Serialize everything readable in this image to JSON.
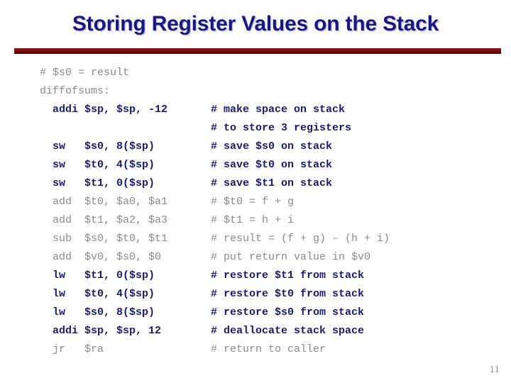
{
  "slide": {
    "title": "Storing Register Values on the Stack",
    "page_number": "11",
    "title_color": "#181880",
    "rule_color": "#7d0f10",
    "highlight_color": "#191970",
    "dim_color": "#8a8a8a"
  },
  "code": {
    "language": "mips-assembly",
    "lines": [
      {
        "text": "# $s0 = result",
        "comment": "",
        "style": "dim"
      },
      {
        "text": "diffofsums:",
        "comment": "",
        "style": "dim"
      },
      {
        "text": "  addi $sp, $sp, -12",
        "comment": "# make space on stack",
        "style": "hl"
      },
      {
        "text": "",
        "comment": "# to store 3 registers",
        "style": "hl"
      },
      {
        "text": "  sw   $s0, 8($sp)",
        "comment": "# save $s0 on stack",
        "style": "hl"
      },
      {
        "text": "  sw   $t0, 4($sp)",
        "comment": "# save $t0 on stack",
        "style": "hl"
      },
      {
        "text": "  sw   $t1, 0($sp)",
        "comment": "# save $t1 on stack",
        "style": "hl"
      },
      {
        "text": "  add  $t0, $a0, $a1",
        "comment": "# $t0 = f + g",
        "style": "dim"
      },
      {
        "text": "  add  $t1, $a2, $a3",
        "comment": "# $t1 = h + i",
        "style": "dim"
      },
      {
        "text": "  sub  $s0, $t0, $t1",
        "comment": "# result = (f + g) – (h + i)",
        "style": "dim"
      },
      {
        "text": "  add  $v0, $s0, $0",
        "comment": "# put return value in $v0",
        "style": "dim"
      },
      {
        "text": "  lw   $t1, 0($sp)",
        "comment": "# restore $t1 from stack",
        "style": "hl"
      },
      {
        "text": "  lw   $t0, 4($sp)",
        "comment": "# restore $t0 from stack",
        "style": "hl"
      },
      {
        "text": "  lw   $s0, 8($sp)",
        "comment": "# restore $s0 from stack",
        "style": "hl"
      },
      {
        "text": "  addi $sp, $sp, 12",
        "comment": "# deallocate stack space",
        "style": "hl"
      },
      {
        "text": "  jr   $ra",
        "comment": "# return to caller",
        "style": "dim"
      }
    ]
  }
}
